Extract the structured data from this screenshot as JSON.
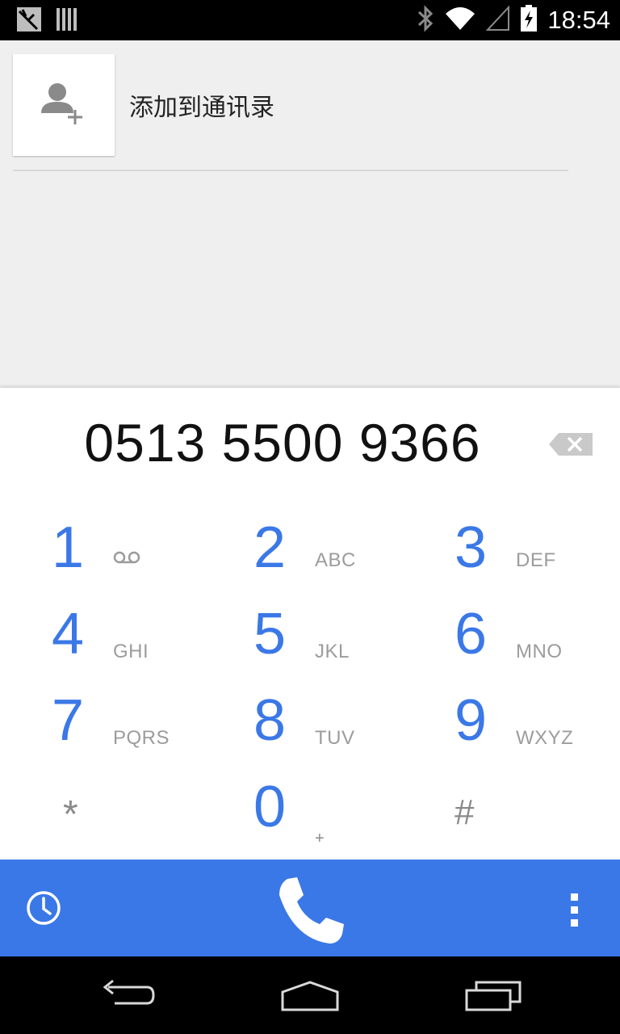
{
  "status_bar": {
    "time": "18:54",
    "icons": [
      "notification-icon",
      "barcode-icon",
      "bluetooth-icon",
      "wifi-icon",
      "signal-icon",
      "battery-charging-icon"
    ]
  },
  "suggestions": {
    "add_contact_label": "添加到通讯录"
  },
  "dialpad": {
    "number": "0513 5500 9366",
    "keys": [
      {
        "digit": "1",
        "letters": ""
      },
      {
        "digit": "2",
        "letters": "ABC"
      },
      {
        "digit": "3",
        "letters": "DEF"
      },
      {
        "digit": "4",
        "letters": "GHI"
      },
      {
        "digit": "5",
        "letters": "JKL"
      },
      {
        "digit": "6",
        "letters": "MNO"
      },
      {
        "digit": "7",
        "letters": "PQRS"
      },
      {
        "digit": "8",
        "letters": "TUV"
      },
      {
        "digit": "9",
        "letters": "WXYZ"
      },
      {
        "digit": "*",
        "letters": ""
      },
      {
        "digit": "0",
        "letters": "+"
      },
      {
        "digit": "#",
        "letters": ""
      }
    ]
  },
  "colors": {
    "accent": "#3b78e7",
    "status_bar": "#000000",
    "background": "#efefef"
  }
}
